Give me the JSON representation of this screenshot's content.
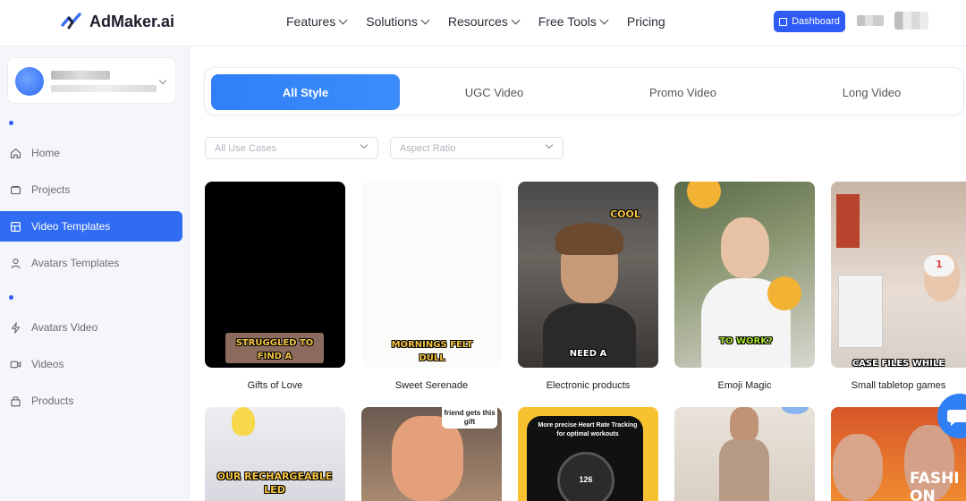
{
  "brand": {
    "name": "AdMaker.ai",
    "accent": "#2f5cf6"
  },
  "topnav": {
    "menu": [
      {
        "label": "Features",
        "dropdown": true
      },
      {
        "label": "Solutions",
        "dropdown": true
      },
      {
        "label": "Resources",
        "dropdown": true
      },
      {
        "label": "Free Tools",
        "dropdown": true
      },
      {
        "label": "Pricing",
        "dropdown": false
      }
    ],
    "dashboard_label": "Dashboard"
  },
  "sidebar": {
    "items": [
      {
        "label": "Home",
        "icon": "home-icon"
      },
      {
        "label": "Projects",
        "icon": "folder-icon"
      },
      {
        "label": "Video Templates",
        "icon": "template-icon",
        "active": true
      },
      {
        "label": "Avatars Templates",
        "icon": "user-icon"
      },
      {
        "label": "Avatars Video",
        "icon": "lightning-icon"
      },
      {
        "label": "Videos",
        "icon": "video-icon"
      },
      {
        "label": "Products",
        "icon": "bag-icon"
      }
    ]
  },
  "tabs": [
    {
      "label": "All Style",
      "active": true
    },
    {
      "label": "UGC Video"
    },
    {
      "label": "Promo Video"
    },
    {
      "label": "Long Video"
    }
  ],
  "filters": {
    "use_cases_placeholder": "All Use Cases",
    "aspect_ratio_placeholder": "Aspect Ratio"
  },
  "templates": [
    {
      "title": "Gifts of Love",
      "caption": "STRUGGLED TO FIND A"
    },
    {
      "title": "Sweet Serenade",
      "caption": "MORNINGS FELT DULL"
    },
    {
      "title": "Electronic products",
      "caption": "NEED A",
      "sticker": "COOL"
    },
    {
      "title": "Emoji Magic",
      "caption": "TO WORK?"
    },
    {
      "title": "Small tabletop games",
      "caption": "CASE FILES WHILE",
      "badge": "1"
    }
  ],
  "templates_row2": [
    {
      "caption": "OUR RECHARGEABLE LED"
    },
    {
      "caption": "friend gets this gift"
    },
    {
      "caption": "More precise Heart Rate Tracking for optimal workouts",
      "watch_value": "126"
    },
    {
      "caption": ""
    },
    {
      "caption": "FASHI ON"
    }
  ]
}
